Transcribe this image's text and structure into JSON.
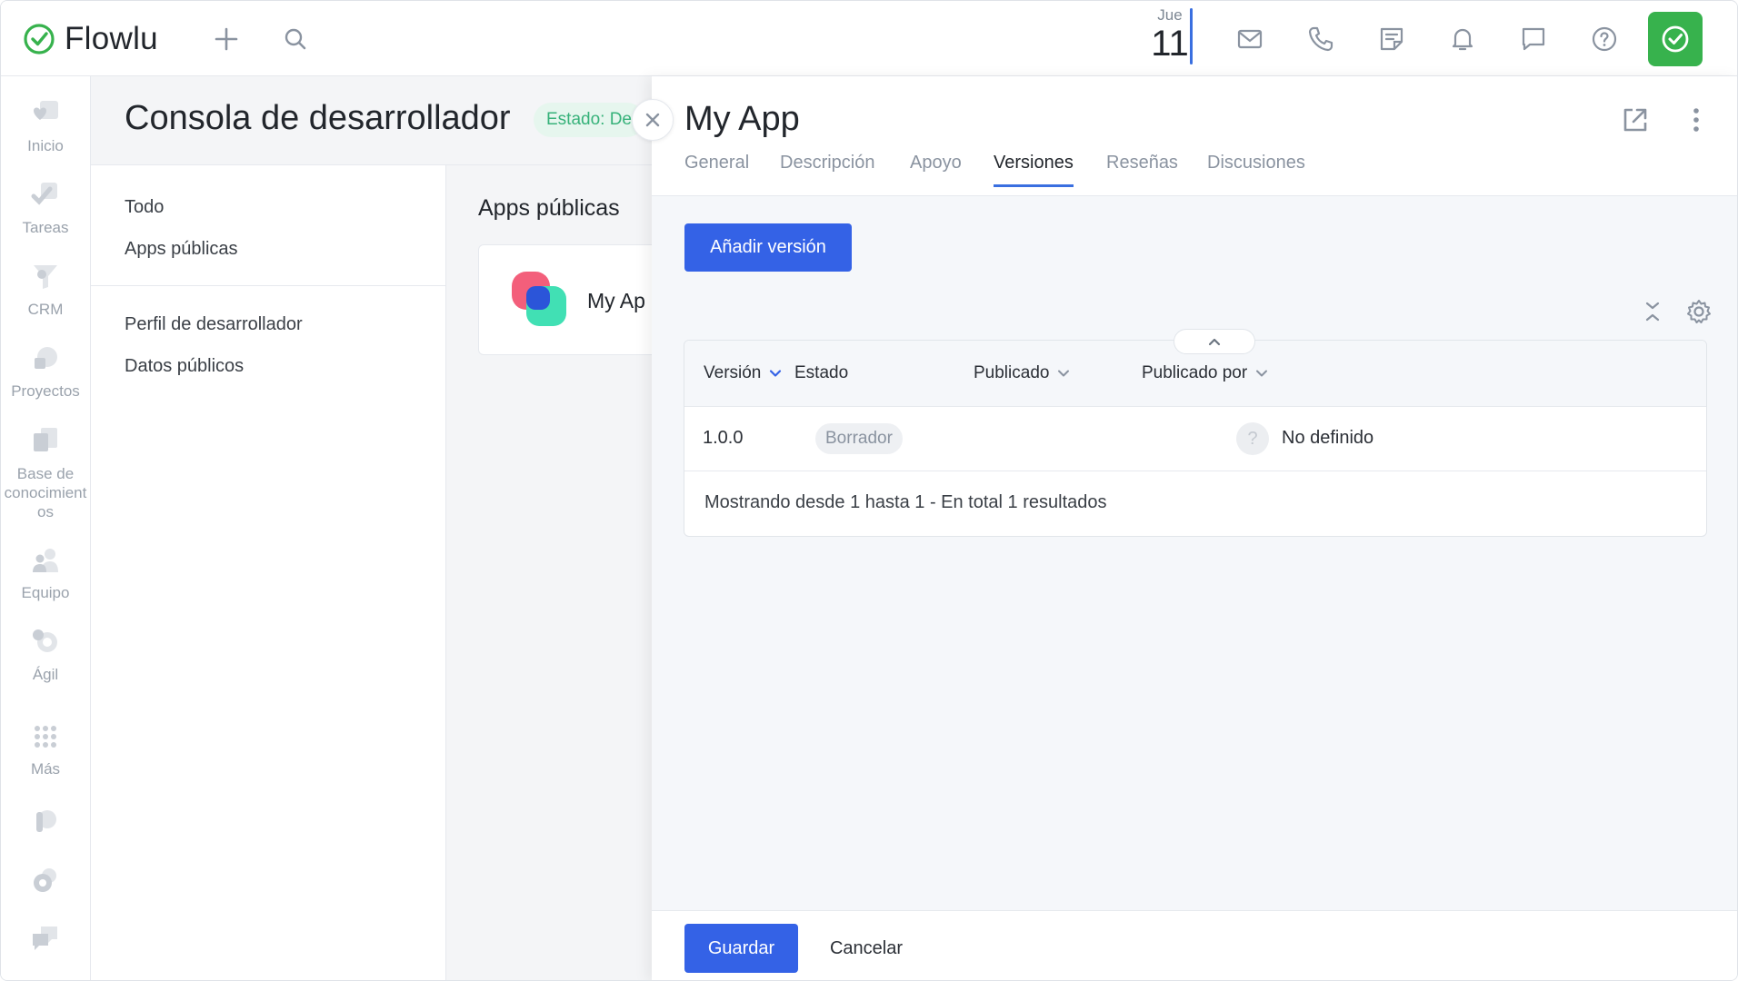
{
  "brand": {
    "name": "Flowlu",
    "accent": "#3462e6",
    "green": "#37b24d"
  },
  "topbar": {
    "date_day": "Jue",
    "date_num": "11",
    "icons": [
      "plus-icon",
      "search-icon",
      "mail-icon",
      "phone-icon",
      "notes-icon",
      "bell-icon",
      "chat-icon",
      "help-icon",
      "check-icon"
    ]
  },
  "sidebar": {
    "items": [
      {
        "label": "Inicio"
      },
      {
        "label": "Tareas"
      },
      {
        "label": "CRM"
      },
      {
        "label": "Proyectos"
      },
      {
        "label": "Base de conocimient os"
      },
      {
        "label": "Equipo"
      },
      {
        "label": "Ágil"
      },
      {
        "label": "Más"
      }
    ]
  },
  "background_page": {
    "title": "Consola de desarrollador",
    "status": "Estado: De",
    "nav": [
      "Todo",
      "Apps públicas",
      "Perfil de desarrollador",
      "Datos públicos"
    ],
    "section_title": "Apps públicas",
    "card_name": "My Ap"
  },
  "panel": {
    "title": "My App",
    "tabs": [
      "General",
      "Descripción",
      "Apoyo",
      "Versiones",
      "Reseñas",
      "Discusiones"
    ],
    "active_tab": "Versiones",
    "add_button": "Añadir versión",
    "table": {
      "columns": [
        "Versión",
        "Estado",
        "Publicado",
        "Publicado por"
      ],
      "rows": [
        {
          "version": "1.0.0",
          "status": "Borrador",
          "published": "",
          "published_by": "No definido",
          "avatar": "?"
        }
      ],
      "footer": "Mostrando desde 1 hasta 1 - En total 1 resultados"
    },
    "save": "Guardar",
    "cancel": "Cancelar"
  }
}
